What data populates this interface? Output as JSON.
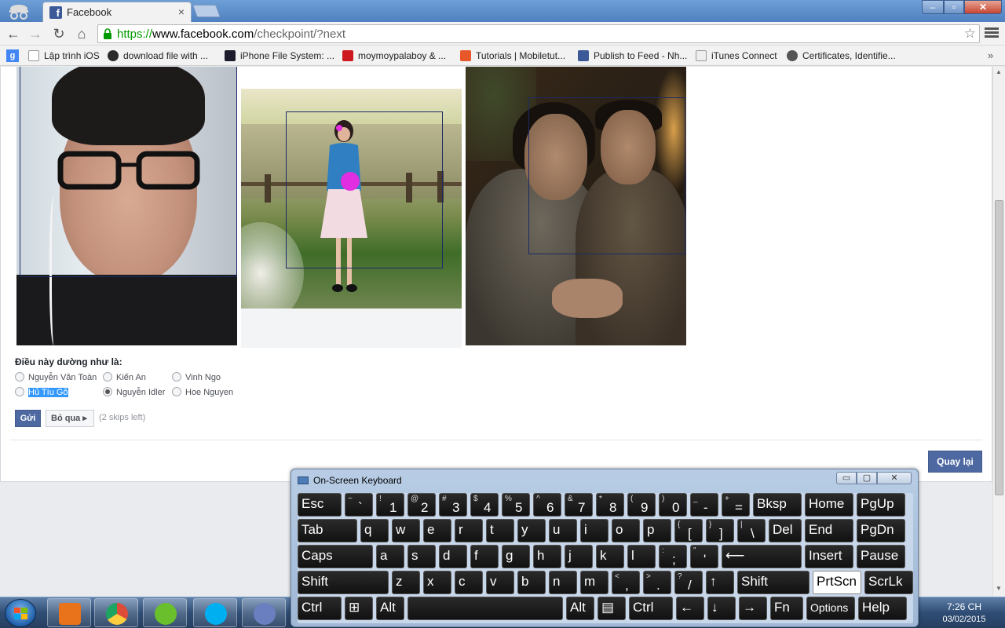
{
  "browser": {
    "tab_title": "Facebook",
    "tab_close": "×",
    "url_scheme": "https://",
    "url_host": "www.facebook.com",
    "url_path": "/checkpoint/?next",
    "bookmarks": [
      {
        "label": "Lập trình iOS",
        "icon": "page-icon",
        "color": "#ffffff"
      },
      {
        "label": "download file with ...",
        "icon": "dropbox-icon",
        "color": "#2a2a2a"
      },
      {
        "label": "iPhone File System: ...",
        "icon": "ios-icon",
        "color": "#1c1c2c"
      },
      {
        "label": "moymoypalaboy & ...",
        "icon": "youtube-icon",
        "color": "#cc181e"
      },
      {
        "label": "Tutorials | Mobiletut...",
        "icon": "plus-icon",
        "color": "#e8572a"
      },
      {
        "label": "Publish to Feed - Nh...",
        "icon": "facebook-icon",
        "color": "#3b5998"
      },
      {
        "label": "iTunes Connect",
        "icon": "page-icon",
        "color": "#cfcfcf"
      },
      {
        "label": "Certificates, Identifie...",
        "icon": "apple-icon",
        "color": "#555555"
      }
    ],
    "bookmarks_more": "»",
    "apps_label": "g"
  },
  "checkpoint": {
    "suggest_label": "Điều này dường như là:",
    "options": [
      {
        "label": "Nguyễn Văn Toàn",
        "checked": false,
        "selected": false
      },
      {
        "label": "Kiến An",
        "checked": false,
        "selected": false
      },
      {
        "label": "Vinh Ngo",
        "checked": false,
        "selected": false
      },
      {
        "label": "Hủ Tíu Gõ",
        "checked": false,
        "selected": true
      },
      {
        "label": "Nguyễn Idler",
        "checked": true,
        "selected": false
      },
      {
        "label": "Hoe Nguyen",
        "checked": false,
        "selected": false
      }
    ],
    "send_label": "Gửi",
    "skip_label": "Bỏ qua ▸",
    "skips_left": "(2 skips left)",
    "back_label": "Quay lại"
  },
  "osk": {
    "title": "On-Screen Keyboard",
    "min": "▭",
    "max": "▢",
    "close": "✕",
    "rows": [
      [
        {
          "m": "Esc"
        },
        {
          "s": "~",
          "m": "`"
        },
        {
          "s": "!",
          "m": "1"
        },
        {
          "s": "@",
          "m": "2"
        },
        {
          "s": "#",
          "m": "3"
        },
        {
          "s": "$",
          "m": "4"
        },
        {
          "s": "%",
          "m": "5"
        },
        {
          "s": "^",
          "m": "6"
        },
        {
          "s": "&",
          "m": "7"
        },
        {
          "s": "*",
          "m": "8"
        },
        {
          "s": "(",
          "m": "9"
        },
        {
          "s": ")",
          "m": "0"
        },
        {
          "s": "_",
          "m": "-"
        },
        {
          "s": "+",
          "m": "="
        },
        {
          "m": "Bksp"
        },
        {
          "m": "Home"
        },
        {
          "m": "PgUp"
        }
      ],
      [
        {
          "m": "Tab"
        },
        {
          "m": "q"
        },
        {
          "m": "w"
        },
        {
          "m": "e"
        },
        {
          "m": "r"
        },
        {
          "m": "t"
        },
        {
          "m": "y"
        },
        {
          "m": "u"
        },
        {
          "m": "i"
        },
        {
          "m": "o"
        },
        {
          "m": "p"
        },
        {
          "s": "{",
          "m": "["
        },
        {
          "s": "}",
          "m": "]"
        },
        {
          "s": "|",
          "m": "\\"
        },
        {
          "m": "Del"
        },
        {
          "m": "End"
        },
        {
          "m": "PgDn"
        }
      ],
      [
        {
          "m": "Caps"
        },
        {
          "m": "a"
        },
        {
          "m": "s"
        },
        {
          "m": "d"
        },
        {
          "m": "f"
        },
        {
          "m": "g"
        },
        {
          "m": "h"
        },
        {
          "m": "j"
        },
        {
          "m": "k"
        },
        {
          "m": "l"
        },
        {
          "s": ":",
          "m": ";"
        },
        {
          "s": "\"",
          "m": "'"
        },
        {
          "m": "⟵"
        },
        {
          "m": "Insert"
        },
        {
          "m": "Pause"
        }
      ],
      [
        {
          "m": "Shift"
        },
        {
          "m": "z"
        },
        {
          "m": "x"
        },
        {
          "m": "c"
        },
        {
          "m": "v"
        },
        {
          "m": "b"
        },
        {
          "m": "n"
        },
        {
          "m": "m"
        },
        {
          "s": "<",
          "m": ","
        },
        {
          "s": ">",
          "m": "."
        },
        {
          "s": "?",
          "m": "/"
        },
        {
          "m": "↑"
        },
        {
          "m": "Shift"
        },
        {
          "m": "PrtScn",
          "light": true
        },
        {
          "m": "ScrLk"
        }
      ],
      [
        {
          "m": "Ctrl"
        },
        {
          "m": "⊞"
        },
        {
          "m": "Alt"
        },
        {
          "m": ""
        },
        {
          "m": "Alt"
        },
        {
          "m": "▤"
        },
        {
          "m": "Ctrl"
        },
        {
          "m": "←"
        },
        {
          "m": "↓"
        },
        {
          "m": "→"
        },
        {
          "m": "Fn"
        },
        {
          "m": "Options"
        },
        {
          "m": "Help"
        }
      ]
    ]
  },
  "taskbar": {
    "time": "7:26 CH",
    "date": "03/02/2015",
    "apps": [
      {
        "name": "media-player-icon",
        "color": "#e8731b"
      },
      {
        "name": "chrome-icon",
        "color": "#dd4b39"
      },
      {
        "name": "unikey-icon",
        "color": "#6abf2c"
      },
      {
        "name": "skype-icon",
        "color": "#00aff0"
      },
      {
        "name": "dolphin-icon",
        "color": "#6a7fc0"
      }
    ]
  }
}
